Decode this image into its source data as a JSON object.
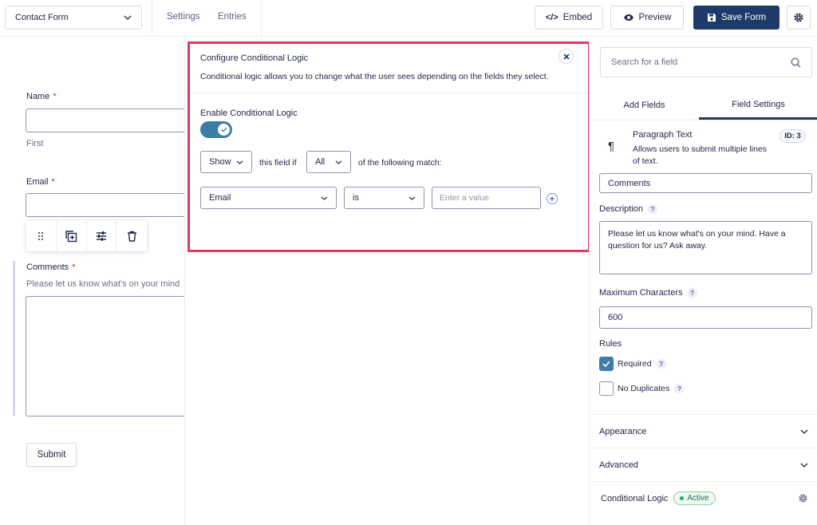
{
  "topbar": {
    "form_selector": "Contact Form",
    "tabs": [
      "Settings",
      "Entries"
    ],
    "embed_label": "Embed",
    "preview_label": "Preview",
    "save_label": "Save Form"
  },
  "form": {
    "name_label": "Name",
    "required_mark": "*",
    "name_sublabel": "First",
    "email_label": "Email",
    "comments_label": "Comments",
    "comments_description": "Please let us know what's on your mind",
    "submit_label": "Submit"
  },
  "modal": {
    "title": "Configure Conditional Logic",
    "description": "Conditional logic allows you to change what the user sees depending on the fields they select.",
    "enable_label": "Enable Conditional Logic",
    "enabled": true,
    "action_value": "Show",
    "text_field_if": "this field if",
    "logic_value": "All",
    "text_following": "of the following match:",
    "rule_field": "Email",
    "rule_operator": "is",
    "rule_value_placeholder": "Enter a value"
  },
  "sidebar": {
    "search_placeholder": "Search for a field",
    "tabs": [
      "Add Fields",
      "Field Settings"
    ],
    "active_tab": "Field Settings",
    "field_type": "Paragraph Text",
    "field_type_desc": "Allows users to submit multiple lines of text.",
    "field_id": "ID: 3",
    "field_label_value": "Comments",
    "description_label": "Description",
    "description_value": "Please let us know what's on your mind. Have a question for us? Ask away.",
    "max_chars_label": "Maximum Characters",
    "max_chars_value": "600",
    "rules_label": "Rules",
    "required_label": "Required",
    "required_checked": true,
    "no_duplicates_label": "No Duplicates",
    "no_duplicates_checked": false,
    "help_mark": "?",
    "appearance_label": "Appearance",
    "advanced_label": "Advanced",
    "conditional_logic_label": "Conditional Logic",
    "conditional_logic_status": "Active"
  },
  "colors": {
    "primary": "#1e3a6b",
    "accent": "#3e7da6",
    "highlight_border": "#e6385d",
    "required": "#c02b0a"
  }
}
